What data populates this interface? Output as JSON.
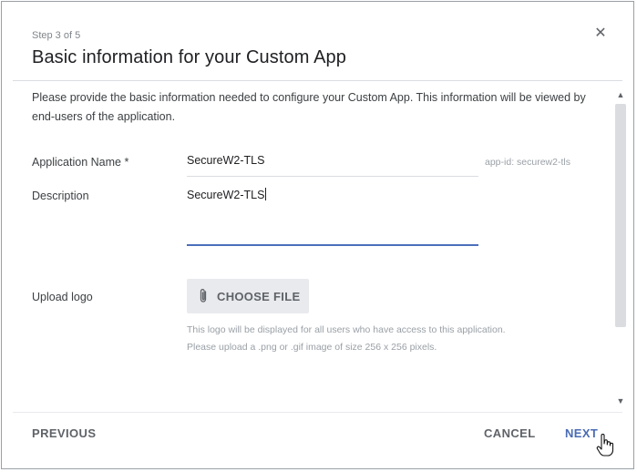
{
  "dialog": {
    "step": "Step 3 of 5",
    "title": "Basic information for your Custom App",
    "close_icon": "close-icon",
    "intro": "Please provide the basic information needed to configure your Custom App. This information will be viewed by end-users of the application."
  },
  "form": {
    "app_name": {
      "label": "Application Name *",
      "value": "SecureW2-TLS",
      "app_id": "app-id: securew2-tls"
    },
    "description": {
      "label": "Description",
      "value": "SecureW2-TLS"
    },
    "logo": {
      "label": "Upload logo",
      "button": "CHOOSE FILE",
      "button_icon": "paperclip-icon",
      "help_line1": "This logo will be displayed for all users who have access to this application.",
      "help_line2": "Please upload a .png or .gif image of size 256 x 256 pixels."
    }
  },
  "footer": {
    "previous": "PREVIOUS",
    "cancel": "CANCEL",
    "next": "NEXT"
  },
  "colors": {
    "accent": "#4a6bb4",
    "active_underline": "#4b6fba",
    "muted_text": "#9aa0a6"
  }
}
